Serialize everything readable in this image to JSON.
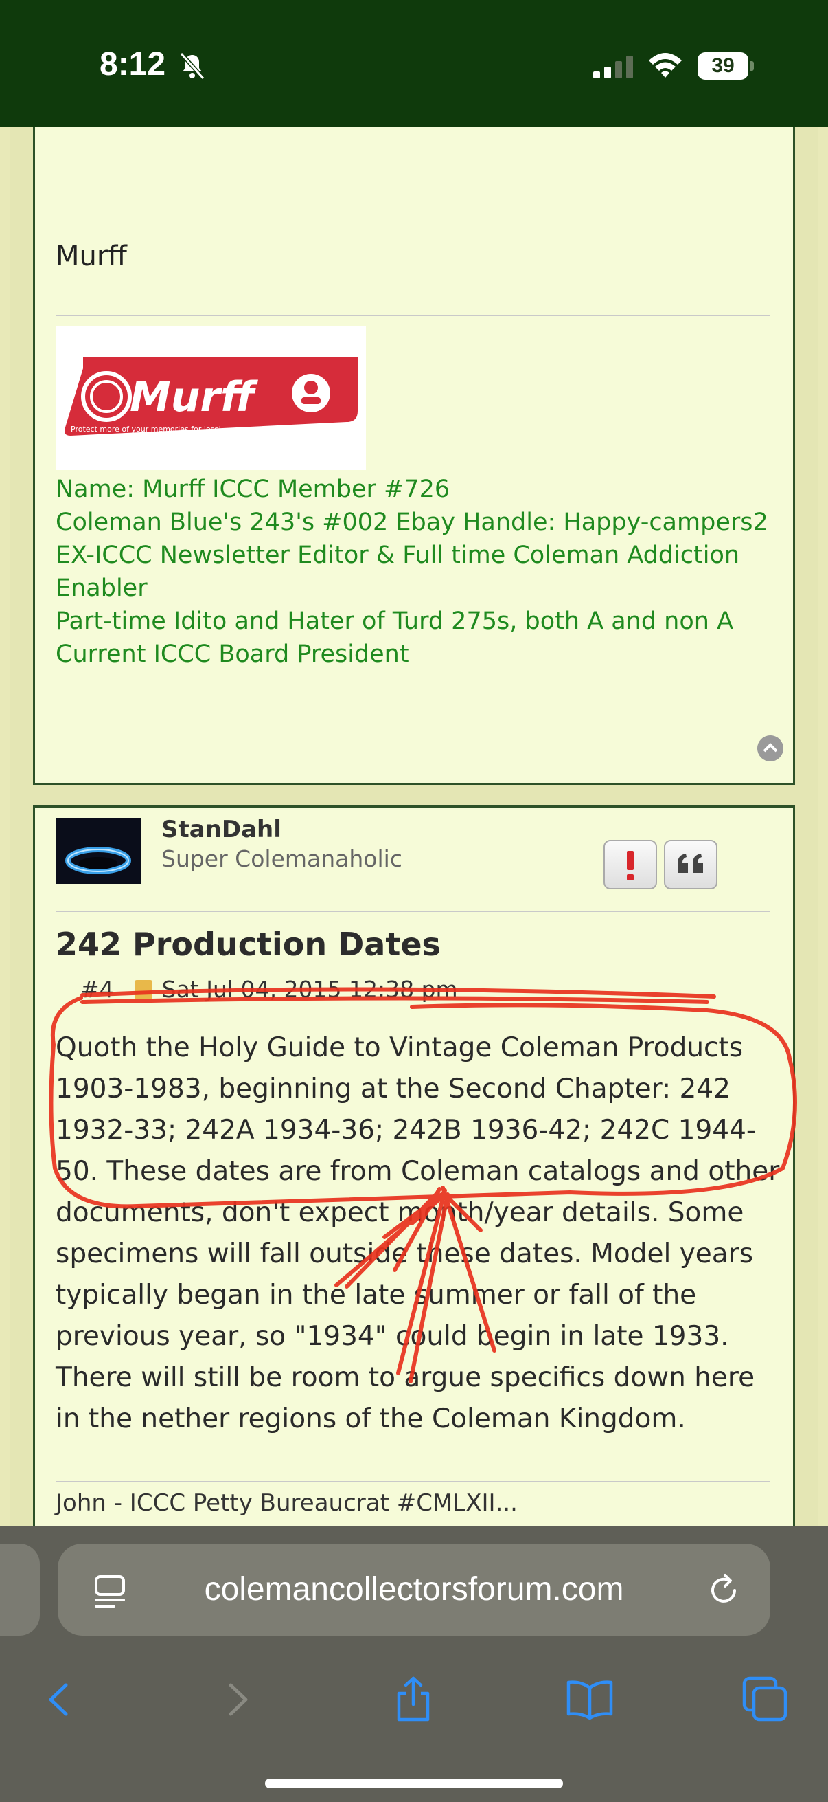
{
  "status_bar": {
    "time": "8:12",
    "battery": "39",
    "icons": [
      "bell-slash-icon",
      "cellular-signal-icon",
      "wifi-icon",
      "battery-icon"
    ]
  },
  "posts": [
    {
      "signature_name": "Murff",
      "logo_text": "Murff",
      "logo_tagline": "Protect more of your memories for less!",
      "signature_lines": [
        "Name: Murff   ICCC Member #726",
        "Coleman Blue's 243's #002   Ebay Handle: Happy-campers2",
        "EX-ICCC Newsletter Editor & Full time Coleman Addiction Enabler",
        "Part-time Idito and Hater of Turd 275s, both A and non A",
        "Current ICCC Board President"
      ]
    },
    {
      "username": "StanDahl",
      "rank": "Super Colemanaholic",
      "title": "242 Production Dates",
      "post_number": "#4",
      "date": "Sat Jul 04, 2015 12:38 pm",
      "body": "Quoth the Holy Guide to Vintage Coleman Products 1903-1983, beginning at the Second Chapter: 242 1932-33; 242A 1934-36; 242B 1936-42; 242C 1944-50. These dates are from Coleman catalogs and other documents, don't expect month/year details. Some specimens will fall outside these dates. Model years typically began in the late summer or fall of the previous year, so \"1934\" could begin in late 1933. There will still be room to argue specifics down here in the nether regions of the Coleman Kingdom.",
      "signature": "John - ICCC Petty Bureaucrat #CMLXII...",
      "report_button": "!",
      "quote_button": "quote-icon"
    }
  ],
  "browser": {
    "url": "colemancollectorsforum.com",
    "toolbar": [
      "back-icon",
      "forward-icon",
      "share-icon",
      "bookmarks-icon",
      "tabs-icon"
    ]
  },
  "colors": {
    "status_bar_bg": "#0f3a0c",
    "post_bg": "#f6fbd8",
    "signature_green": "#1f8a1f",
    "annotation_red": "#e8321e"
  }
}
